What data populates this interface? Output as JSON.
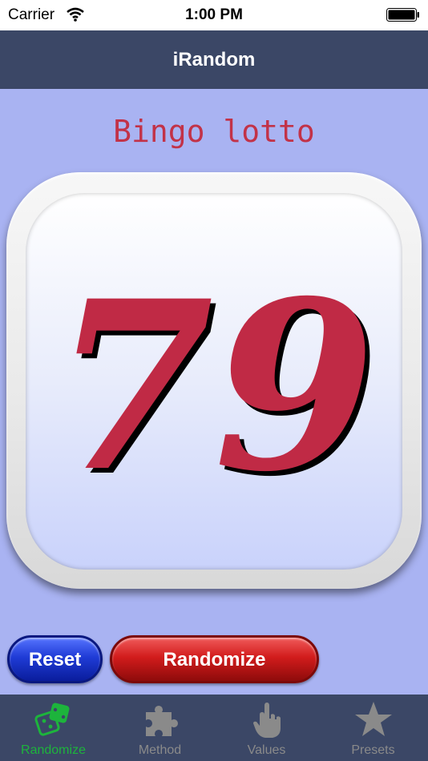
{
  "status_bar": {
    "carrier": "Carrier",
    "time": "1:00 PM"
  },
  "nav": {
    "title": "iRandom"
  },
  "main": {
    "method_title": "Bingo lotto",
    "result": "79",
    "result_color": "#c02a45"
  },
  "buttons": {
    "reset_label": "Reset",
    "randomize_label": "Randomize"
  },
  "tabs": [
    {
      "label": "Randomize",
      "icon": "dice-icon",
      "active": true
    },
    {
      "label": "Method",
      "icon": "puzzle-icon",
      "active": false
    },
    {
      "label": "Values",
      "icon": "hand-pointer-icon",
      "active": false
    },
    {
      "label": "Presets",
      "icon": "star-icon",
      "active": false
    }
  ],
  "colors": {
    "nav_background": "#3b4766",
    "content_background": "#a9b3f2",
    "active_tab": "#1db43c",
    "inactive_tab": "#8a8a8a",
    "title_text": "#c23248"
  }
}
